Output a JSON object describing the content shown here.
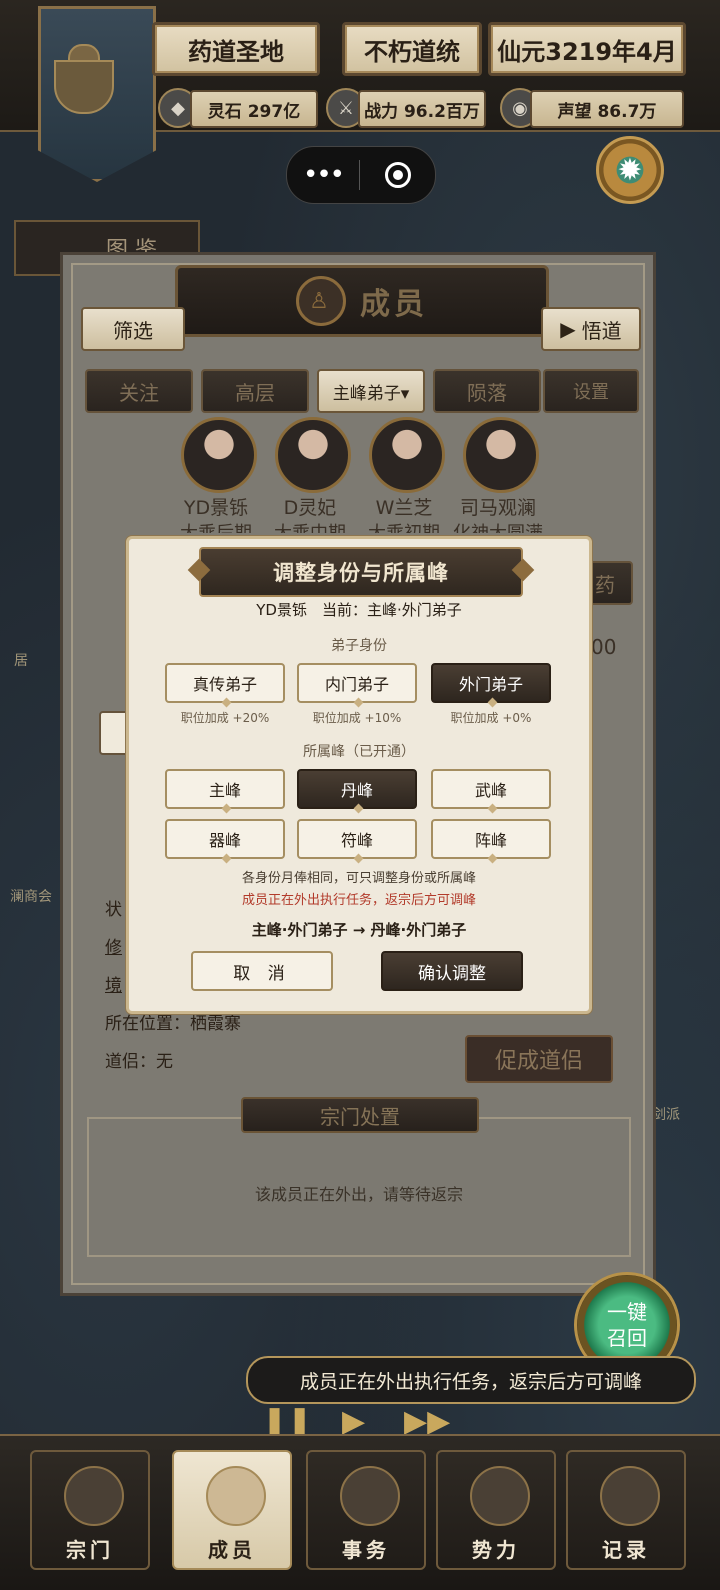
{
  "header": {
    "sect_name": "药道圣地",
    "lineage": "不朽道统",
    "date": "仙元3219年4月",
    "stats": [
      {
        "icon": "spirit-stone-icon",
        "text": "灵石 297亿"
      },
      {
        "icon": "sword-icon",
        "text": "战力 96.2百万"
      },
      {
        "icon": "reputation-icon",
        "text": "声望 86.7万"
      }
    ],
    "side_tab": "图 鉴"
  },
  "map_labels": [
    "居",
    "澜商会",
    "剑派"
  ],
  "members": {
    "title": "成员",
    "filter": "筛选",
    "enlighten": "悟道",
    "tabs": [
      "关注",
      "高层",
      "主峰弟子▾",
      "陨落",
      "设置"
    ],
    "avatars": [
      {
        "name": "YD景铄",
        "stage": "大乘后期"
      },
      {
        "name": "D灵妃",
        "stage": "大乘中期"
      },
      {
        "name": "W兰芝",
        "stage": "大乘初期"
      },
      {
        "name": "司马观澜",
        "stage": "化神大圆满"
      }
    ],
    "partial_right_label": "药",
    "partial_number": "00",
    "info": {
      "status_partial": "状",
      "cultivation_partial": "修",
      "realm_partial": "境",
      "location": "所在位置：栖霞寨",
      "companion": "道侣：无"
    },
    "make_companion": "促成道侣",
    "sect_action_title": "宗门处置",
    "sect_action_msg": "该成员正在外出，请等待返宗"
  },
  "modal": {
    "title": "调整身份与所属峰",
    "current": "YD景铄　当前：主峰·外门弟子",
    "identity_label": "弟子身份",
    "identities": [
      {
        "label": "真传弟子",
        "bonus": "职位加成 +20%",
        "selected": false
      },
      {
        "label": "内门弟子",
        "bonus": "职位加成 +10%",
        "selected": false
      },
      {
        "label": "外门弟子",
        "bonus": "职位加成 +0%",
        "selected": true
      }
    ],
    "peak_label": "所属峰（已开通）",
    "peaks": [
      {
        "label": "主峰",
        "selected": false
      },
      {
        "label": "丹峰",
        "selected": true
      },
      {
        "label": "武峰",
        "selected": false
      },
      {
        "label": "器峰",
        "selected": false
      },
      {
        "label": "符峰",
        "selected": false
      },
      {
        "label": "阵峰",
        "selected": false
      }
    ],
    "note": "各身份月俸相同，可只调整身份或所属峰",
    "warning": "成员正在外出执行任务，返宗后方可调峰",
    "change": "主峰·外门弟子 → 丹峰·外门弟子",
    "cancel": "取 消",
    "confirm": "确认调整",
    "warning_color": "#b23a2a"
  },
  "recall": {
    "line1": "一键",
    "line2": "召回"
  },
  "toast": "成员正在外出执行任务，返宗后方可调峰",
  "nav": [
    {
      "label": "宗门",
      "icon": "sect-gate-icon",
      "active": false
    },
    {
      "label": "成员",
      "icon": "member-icon",
      "active": true
    },
    {
      "label": "事务",
      "icon": "scroll-icon",
      "active": false
    },
    {
      "label": "势力",
      "icon": "faction-banner-icon",
      "active": false
    },
    {
      "label": "记录",
      "icon": "book-icon",
      "active": false
    }
  ]
}
